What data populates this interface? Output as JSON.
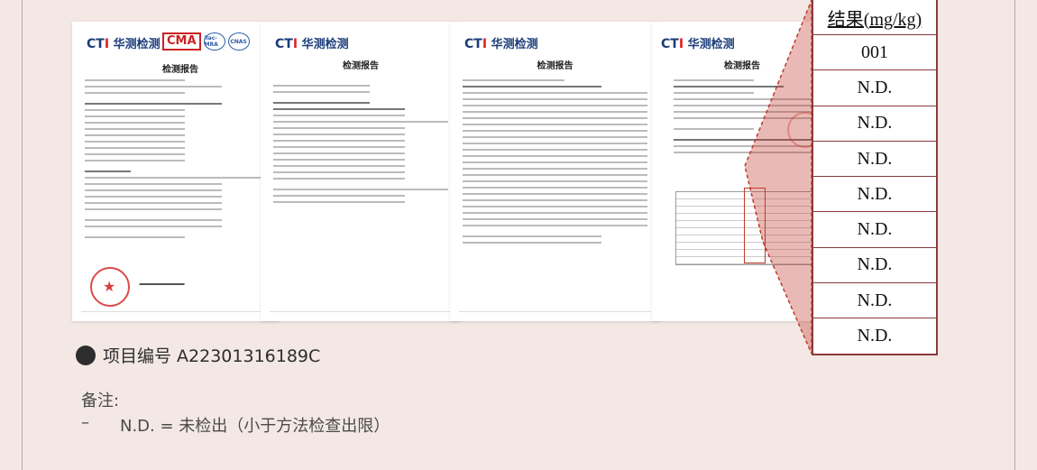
{
  "documents": [
    {
      "logo_ct": "CT",
      "logo_i": "I",
      "logo_cn": " 华测检测",
      "title": "检测报告",
      "cert_cma": "CMA",
      "cert_ilac": "ilac-MRA",
      "cert_cnas": "CNAS"
    },
    {
      "logo_ct": "CT",
      "logo_i": "I",
      "logo_cn": " 华测检测",
      "title": "检测报告"
    },
    {
      "logo_ct": "CT",
      "logo_i": "I",
      "logo_cn": " 华测检测",
      "title": "检测报告"
    },
    {
      "logo_ct": "CT",
      "logo_i": "I",
      "logo_cn": " 华测检测",
      "title": "检测报告"
    }
  ],
  "result_table": {
    "header": "结果(mg/kg)",
    "rows": [
      "001",
      "N.D.",
      "N.D.",
      "N.D.",
      "N.D.",
      "N.D.",
      "N.D.",
      "N.D.",
      "N.D."
    ]
  },
  "project": {
    "label": "项目编号 A22301316189C"
  },
  "notes": {
    "title": "备注:",
    "dash": "–",
    "item": "N.D. = 未检出（小于方法检查出限）"
  },
  "colors": {
    "accent": "#8b3a3a",
    "wedge": "#c0392b",
    "background": "#f3e8e4"
  }
}
